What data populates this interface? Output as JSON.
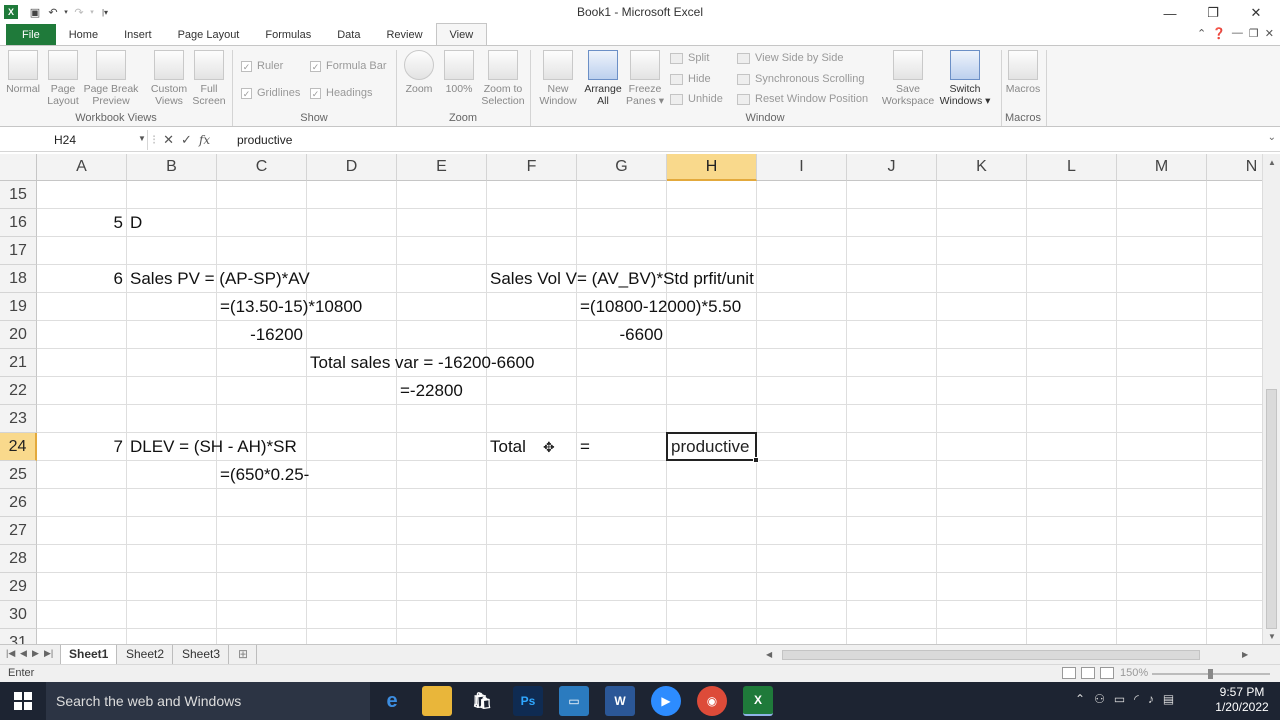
{
  "titlebar": {
    "title": "Book1  -  Microsoft Excel",
    "app_icon": "excel-icon"
  },
  "tabs": [
    "File",
    "Home",
    "Insert",
    "Page Layout",
    "Formulas",
    "Data",
    "Review",
    "View"
  ],
  "active_tab": "View",
  "ribbon": {
    "workbook_views": {
      "label": "Workbook Views",
      "buttons": [
        {
          "line1": "Normal",
          "line2": ""
        },
        {
          "line1": "Page",
          "line2": "Layout"
        },
        {
          "line1": "Page Break",
          "line2": "Preview"
        },
        {
          "line1": "Custom",
          "line2": "Views"
        },
        {
          "line1": "Full",
          "line2": "Screen"
        }
      ]
    },
    "show": {
      "label": "Show",
      "checks": [
        {
          "label": "Ruler",
          "checked": true
        },
        {
          "label": "Formula Bar",
          "checked": true
        },
        {
          "label": "Gridlines",
          "checked": true
        },
        {
          "label": "Headings",
          "checked": true
        }
      ]
    },
    "zoom": {
      "label": "Zoom",
      "buttons": [
        {
          "line1": "Zoom",
          "line2": ""
        },
        {
          "line1": "100%",
          "line2": ""
        },
        {
          "line1": "Zoom to",
          "line2": "Selection"
        }
      ]
    },
    "window": {
      "label": "Window",
      "buttons": [
        {
          "line1": "New",
          "line2": "Window"
        },
        {
          "line1": "Arrange",
          "line2": "All"
        },
        {
          "line1": "Freeze",
          "line2": "Panes ▾"
        }
      ],
      "small": [
        "Split",
        "Hide",
        "Unhide"
      ],
      "side": [
        "View Side by Side",
        "Synchronous Scrolling",
        "Reset Window Position"
      ],
      "right_buttons": [
        {
          "line1": "Save",
          "line2": "Workspace"
        },
        {
          "line1": "Switch",
          "line2": "Windows ▾"
        }
      ]
    },
    "macros": {
      "label": "Macros",
      "buttons": [
        {
          "line1": "Macros",
          "line2": ""
        }
      ]
    }
  },
  "formula_bar": {
    "name_box": "H24",
    "formula": "productive"
  },
  "grid": {
    "columns": [
      "A",
      "B",
      "C",
      "D",
      "E",
      "F",
      "G",
      "H",
      "I",
      "J",
      "K",
      "L",
      "M",
      "N"
    ],
    "selected_column": "H",
    "rows": [
      "15",
      "16",
      "17",
      "18",
      "19",
      "20",
      "21",
      "22",
      "23",
      "24",
      "25",
      "26",
      "27",
      "28",
      "29",
      "30",
      "31"
    ],
    "selected_row": "24",
    "cells": [
      {
        "ref": "A16",
        "text": "5",
        "align": "right"
      },
      {
        "ref": "B16",
        "text": "D"
      },
      {
        "ref": "A18",
        "text": "6",
        "align": "right"
      },
      {
        "ref": "B18",
        "text": "Sales PV = (AP-SP)*AV"
      },
      {
        "ref": "F18",
        "text": "Sales Vol V= (AV_BV)*Std prfit/unit"
      },
      {
        "ref": "C19",
        "text": "=(13.50-15)*10800"
      },
      {
        "ref": "G19",
        "text": "=(10800-12000)*5.50"
      },
      {
        "ref": "C20",
        "text": "-16200",
        "align": "right"
      },
      {
        "ref": "G20",
        "text": "-6600",
        "align": "right"
      },
      {
        "ref": "D21",
        "text": "Total sales var = -16200-6600"
      },
      {
        "ref": "E22",
        "text": "=-22800"
      },
      {
        "ref": "A24",
        "text": "7",
        "align": "right"
      },
      {
        "ref": "B24",
        "text": "DLEV = (SH - AH)*SR"
      },
      {
        "ref": "F24",
        "text": "Total"
      },
      {
        "ref": "G24",
        "text": "="
      },
      {
        "ref": "C25",
        "text": "=(650*0.25-"
      }
    ],
    "active_cell": {
      "ref": "H24",
      "text": "productive"
    }
  },
  "sheets": [
    "Sheet1",
    "Sheet2",
    "Sheet3"
  ],
  "active_sheet": "Sheet1",
  "status": {
    "mode": "Enter",
    "zoom": "150%"
  },
  "taskbar": {
    "search_placeholder": "Search the web and Windows",
    "apps": [
      "edge-icon",
      "file-explorer-icon",
      "store-icon",
      "photoshop-icon",
      "app-icon",
      "word-icon",
      "zoom-icon",
      "chrome-icon",
      "excel-icon"
    ],
    "time": "9:57 PM",
    "date": "1/20/2022"
  },
  "colors": {
    "file_tab": "#1f7a3a",
    "selected_header": "#f9d98c",
    "taskbar": "#1d2432"
  }
}
